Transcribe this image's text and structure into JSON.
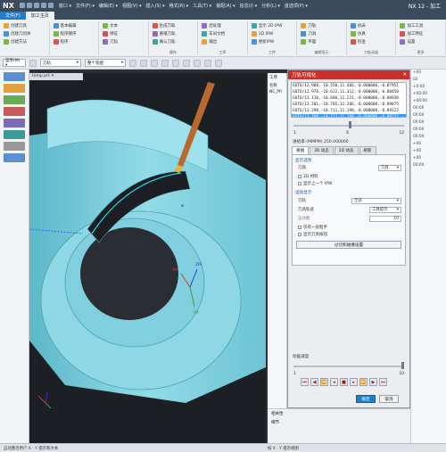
{
  "titlebar": {
    "logo": "NX",
    "menus": [
      "窗口 ▾",
      "文件(F) ▾",
      "编辑(E) ▾",
      "视图(V) ▾",
      "插入(S) ▾",
      "格式(R) ▾",
      "工具(T) ▾",
      "装配(A) ▾",
      "信息(I) ▾",
      "分析(L) ▾",
      "首选项(P) ▾",
      "应用模块(N) ▾",
      "窗口(O) ▾",
      "GC工具箱 ▾",
      "帮助(H) ▾"
    ],
    "app_title": "NX 12 - 加工"
  },
  "ribbon_tabs": {
    "file": "文件(F)",
    "active": "加工主页"
  },
  "ribbon": {
    "groups": [
      {
        "label": "",
        "items": [
          "创建刀具",
          "创建几何体",
          "创建方法"
        ]
      },
      {
        "label": "",
        "items": [
          "基本编辑",
          "程序顺序",
          "程序"
        ]
      },
      {
        "label": "",
        "items": [
          "文本",
          "特征",
          "刀轨"
        ]
      },
      {
        "label": "操作",
        "items": [
          "生成刀轨",
          "重播刀轨",
          "确认刀轨"
        ]
      },
      {
        "label": "工序",
        "items": [
          "后处理",
          "车间文档",
          "输出"
        ]
      },
      {
        "label": "工件",
        "items": [
          "显示 2D IPW",
          "3D IPW",
          "更新IPW"
        ]
      },
      {
        "label": "编辑显示",
        "items": [
          "刀轨",
          "刀具",
          "平面"
        ]
      },
      {
        "label": "刀轨动画",
        "items": [
          "机床",
          "仿真",
          "检查"
        ]
      },
      {
        "label": "更多",
        "items": [
          "加工工具",
          "加工特征",
          "设置"
        ]
      }
    ]
  },
  "toolbar": {
    "menu_label": "菜单(M) ▾",
    "filter_value": "刀轨",
    "assembly_value": "整个装配"
  },
  "viewport": {
    "doc_tab": "temp.prt ✕",
    "axes": {
      "xm": "XM",
      "ym": "YM",
      "zm": "ZM"
    }
  },
  "nav_panel": {
    "header": "工序",
    "items": [
      "名称",
      "NC_PR"
    ]
  },
  "dialog": {
    "title": "刀轨可视化",
    "close": "✕",
    "gcode": [
      "GOTO/12.908,-10.550,11.406,-0.000000,-0.87951",
      "GOTO/12.970,-10.622,11.312,-0.000000,-0.88450",
      "GOTO/13.110,-10.686,11.221,-0.000000,-0.88930",
      "GOTO/13.201,-10.705,11.206,-0.000000,-0.89075",
      "GOTO/13.298,-10.711,11.198,-0.000000,-0.89122",
      "GOTO/13.298,-10.711,11.198,-0.000000,-0.89122"
    ],
    "slider_min": "1",
    "slider_mid": "6",
    "slider_max": "12",
    "feed_label": "进给率 (MMPM) 250.000000",
    "tabs": [
      "重播",
      "3D 动态",
      "2D 动态",
      "刷新"
    ],
    "display_options": "显示选项",
    "tool_label": "刀具",
    "tool_value": "刀具",
    "ipw_2d": "2D 材料",
    "show_prev_ipw": "显示上一个 IPW",
    "motion_display": "运动显示",
    "tool_ddl_label": "刀轨",
    "tool_ddl_value": "全部",
    "tool_track_label": "刀具轨迹",
    "tool_track_value": "工具提示",
    "motion_count_label": "运动数",
    "motion_count_value": "10",
    "check_next": "仅有一层框手",
    "show_tool_shape": "显示刀具按钮",
    "filter_btn": "过切和碰撞设置",
    "anim_speed": "动画速度",
    "speed_min": "1",
    "speed_max": "10",
    "speed_value": "10",
    "play_buttons": [
      "⏮",
      "◀",
      "⏪",
      "◂",
      "■",
      "▸",
      "⏩",
      "▶",
      "⏭"
    ],
    "ok": "确定",
    "cancel": "取消"
  },
  "right_panel": {
    "items": [
      "+00",
      "02",
      "+0:00",
      "+00:00",
      "+00:00",
      "00:00",
      "00:00",
      "00:00",
      "00:00",
      "00:00",
      "+00",
      "+00",
      "+00",
      "00:00"
    ]
  },
  "bottom_panel": {
    "items": [
      "相关性",
      "细节"
    ]
  },
  "status": {
    "left": "自动激活用户 X - Y 提示和文本",
    "right": "按 X - Y 提示视图"
  },
  "colors": {
    "part": "#8ed8e6",
    "viewport_bg": "#1c1f24",
    "dialog_title": "#c9302c",
    "title_bar": "#3b4b5e",
    "file_tab": "#1e7fc8"
  }
}
